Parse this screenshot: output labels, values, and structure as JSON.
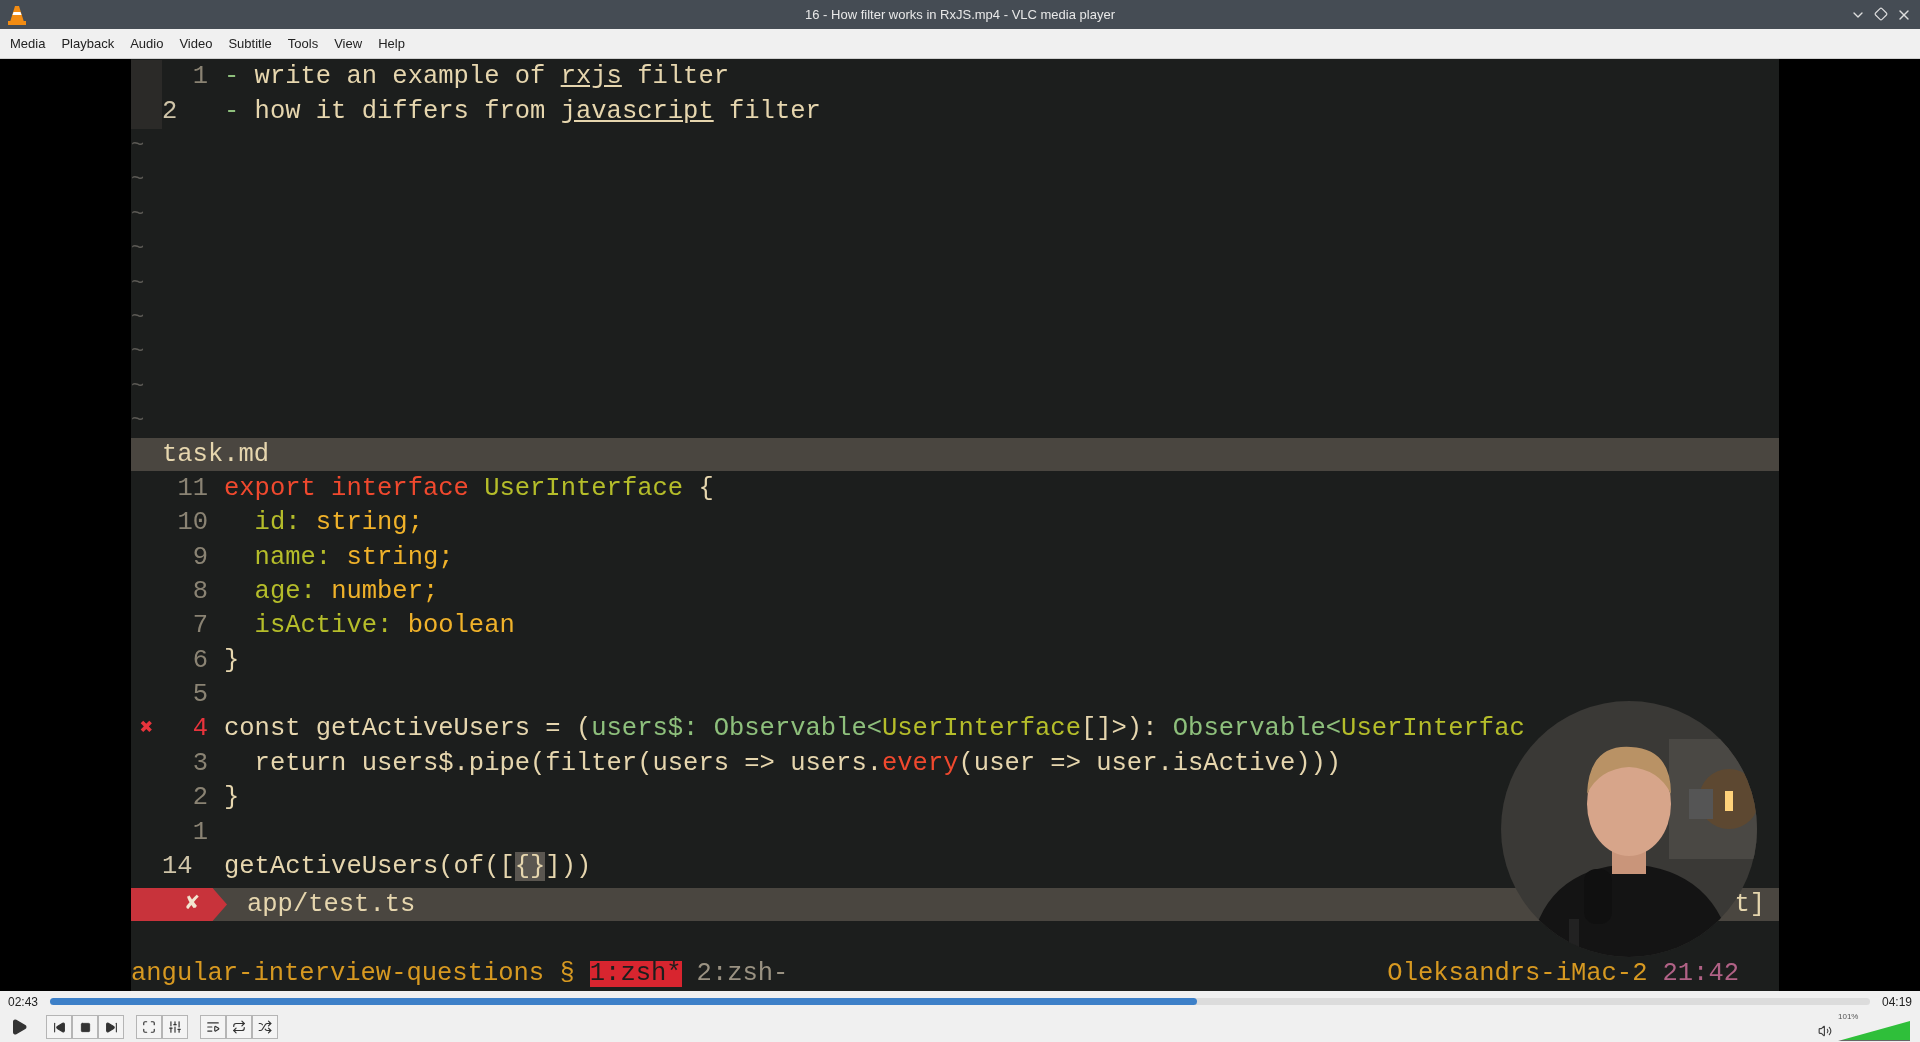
{
  "window": {
    "title": "16 - How filter works in RxJS.mp4 - VLC media player"
  },
  "menu": [
    "Media",
    "Playback",
    "Audio",
    "Video",
    "Subtitle",
    "Tools",
    "View",
    "Help"
  ],
  "video": {
    "top_pane": {
      "lines": [
        {
          "number": "1",
          "current": false,
          "error": false,
          "segments": [
            {
              "text": "- ",
              "kind": "aqua"
            },
            {
              "text": "write an example of ",
              "kind": "text"
            },
            {
              "text": "rxjs",
              "kind": "link"
            },
            {
              "text": " filter",
              "kind": "text"
            }
          ]
        },
        {
          "number": "2",
          "current": true,
          "error": false,
          "segments": [
            {
              "text": "- ",
              "kind": "aqua"
            },
            {
              "text": "how it differs from ",
              "kind": "text"
            },
            {
              "text": "javascript",
              "kind": "link"
            },
            {
              "text": " filter",
              "kind": "text"
            }
          ]
        }
      ],
      "tildes": [
        "~",
        "~",
        "~",
        "~",
        "~",
        "~",
        "~",
        "~",
        "~"
      ]
    },
    "pane_status": "task.md",
    "code": {
      "sign": "✖",
      "lines": [
        {
          "number": "11",
          "current": false,
          "error": false,
          "segments": [
            {
              "text": "export interface ",
              "kind": "keyword"
            },
            {
              "text": "UserInterface",
              "kind": "type"
            },
            {
              "text": " {",
              "kind": "text"
            }
          ]
        },
        {
          "number": "10",
          "current": false,
          "error": false,
          "segments": [
            {
              "text": "  id: ",
              "kind": "type"
            },
            {
              "text": "string;",
              "kind": "builtin"
            }
          ]
        },
        {
          "number": "9",
          "current": false,
          "error": false,
          "segments": [
            {
              "text": "  name: ",
              "kind": "type"
            },
            {
              "text": "string;",
              "kind": "builtin"
            }
          ]
        },
        {
          "number": "8",
          "current": false,
          "error": false,
          "segments": [
            {
              "text": "  age: ",
              "kind": "type"
            },
            {
              "text": "number;",
              "kind": "builtin"
            }
          ]
        },
        {
          "number": "7",
          "current": false,
          "error": false,
          "segments": [
            {
              "text": "  isActive: ",
              "kind": "type"
            },
            {
              "text": "boolean",
              "kind": "builtin"
            }
          ]
        },
        {
          "number": "6",
          "current": false,
          "error": false,
          "segments": [
            {
              "text": "}",
              "kind": "text"
            }
          ]
        },
        {
          "number": "5",
          "current": false,
          "error": false
        },
        {
          "number": "4",
          "current": false,
          "error": true,
          "segments": [
            {
              "text": "const getActiveUsers = (",
              "kind": "text"
            },
            {
              "text": "users$: Observable<",
              "kind": "aqua"
            },
            {
              "text": "UserInterface",
              "kind": "type"
            },
            {
              "text": "[]>): ",
              "kind": "text"
            },
            {
              "text": "Observable<",
              "kind": "aqua"
            },
            {
              "text": "UserInterfac",
              "kind": "type"
            }
          ]
        },
        {
          "number": "3",
          "current": false,
          "error": false,
          "segments": [
            {
              "text": "  return users$.pipe(filter(users => users.",
              "kind": "text"
            },
            {
              "text": "every",
              "kind": "keyword"
            },
            {
              "text": "(user => user.isActive)))",
              "kind": "text"
            }
          ]
        },
        {
          "number": "2",
          "current": false,
          "error": false,
          "segments": [
            {
              "text": "}",
              "kind": "text"
            }
          ]
        },
        {
          "number": "1",
          "current": false,
          "error": false
        },
        {
          "number": "14",
          "current": true,
          "error": false,
          "segments": [
            {
              "text": "getActiveUsers(of([",
              "kind": "text"
            },
            {
              "text": "{}",
              "kind": "cursor"
            },
            {
              "text": "]))",
              "kind": "text"
            }
          ]
        }
      ]
    },
    "error_bar": {
      "mark": "✘",
      "file": "app/test.ts",
      "tail": "t]"
    },
    "tmux": {
      "session": "angular-interview-questions §",
      "windows": [
        {
          "label": "1:zsh*",
          "selected": true
        },
        {
          "label": "2:zsh-",
          "selected": false
        }
      ],
      "host": "Oleksandrs-iMac-2",
      "time": "21:42"
    }
  },
  "playback": {
    "elapsed": "02:43",
    "total": "04:19",
    "level": 0.63
  },
  "volume": {
    "label": "101%",
    "level": 1
  }
}
